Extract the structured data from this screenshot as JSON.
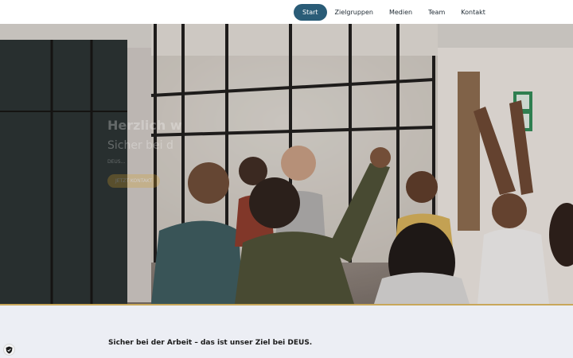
{
  "nav": {
    "items": [
      {
        "label": "Start",
        "active": true
      },
      {
        "label": "Zielgruppen",
        "active": false
      },
      {
        "label": "Medien",
        "active": false
      },
      {
        "label": "Team",
        "active": false
      },
      {
        "label": "Kontakt",
        "active": false
      }
    ]
  },
  "hero": {
    "title": "Herzlich w",
    "subtitle": "Sicher bei d",
    "small_text": "DEUS...",
    "button_label": "JETZT KONTAKT",
    "exit_sign_icon": "emergency-exit-icon"
  },
  "section": {
    "intro": "Sicher bei der Arbeit – das ist unser Ziel bei DEUS."
  },
  "privacy_badge_icon": "shield-check-icon",
  "colors": {
    "nav_active_bg": "#2a5c77",
    "accent_line": "#c8a75a",
    "lower_bg": "#eceef4",
    "hero_button": "#d8a12a"
  }
}
